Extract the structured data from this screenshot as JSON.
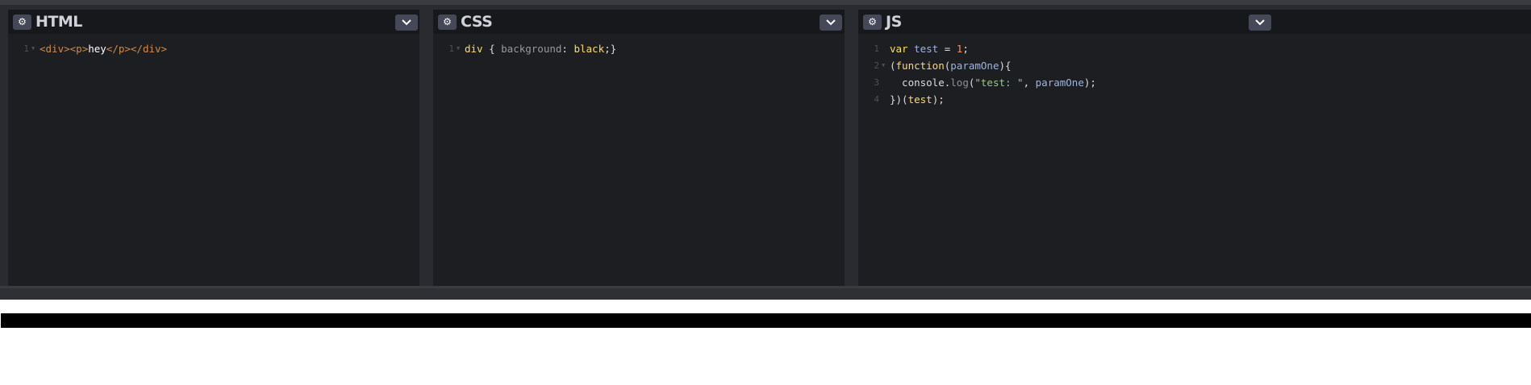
{
  "panels": [
    {
      "title": "HTML",
      "lines": [
        {
          "n": "1",
          "fold": true,
          "tokens": [
            {
              "t": "<div>",
              "c": "t-tag"
            },
            {
              "t": "<p>",
              "c": "t-tag"
            },
            {
              "t": "hey",
              "c": "t-text"
            },
            {
              "t": "</p>",
              "c": "t-tag"
            },
            {
              "t": "</div>",
              "c": "t-tag"
            }
          ]
        }
      ]
    },
    {
      "title": "CSS",
      "lines": [
        {
          "n": "1",
          "fold": true,
          "tokens": [
            {
              "t": "div",
              "c": "t-kw"
            },
            {
              "t": " { ",
              "c": "t-punc"
            },
            {
              "t": "background",
              "c": "t-prop"
            },
            {
              "t": ": ",
              "c": "t-punc"
            },
            {
              "t": "black",
              "c": "t-val"
            },
            {
              "t": ";}",
              "c": "t-punc"
            }
          ]
        }
      ]
    },
    {
      "title": "JS",
      "lines": [
        {
          "n": "1",
          "fold": false,
          "tokens": [
            {
              "t": "var",
              "c": "t-kw"
            },
            {
              "t": " ",
              "c": "t-punc"
            },
            {
              "t": "test",
              "c": "t-var"
            },
            {
              "t": " = ",
              "c": "t-punc"
            },
            {
              "t": "1",
              "c": "t-num"
            },
            {
              "t": ";",
              "c": "t-punc"
            }
          ]
        },
        {
          "n": "2",
          "fold": true,
          "tokens": [
            {
              "t": "(",
              "c": "t-punc"
            },
            {
              "t": "function",
              "c": "t-kw"
            },
            {
              "t": "(",
              "c": "t-punc"
            },
            {
              "t": "paramOne",
              "c": "t-var"
            },
            {
              "t": "){",
              "c": "t-punc"
            }
          ]
        },
        {
          "n": "3",
          "fold": false,
          "tokens": [
            {
              "t": "  console",
              "c": "t-obj"
            },
            {
              "t": ".",
              "c": "t-punc"
            },
            {
              "t": "log",
              "c": "t-meth"
            },
            {
              "t": "(",
              "c": "t-punc"
            },
            {
              "t": "\"test: \"",
              "c": "t-str"
            },
            {
              "t": ", ",
              "c": "t-punc"
            },
            {
              "t": "paramOne",
              "c": "t-var"
            },
            {
              "t": ");",
              "c": "t-punc"
            }
          ]
        },
        {
          "n": "4",
          "fold": false,
          "tokens": [
            {
              "t": "})(",
              "c": "t-punc"
            },
            {
              "t": "test",
              "c": "t-param"
            },
            {
              "t": ");",
              "c": "t-punc"
            }
          ]
        }
      ]
    }
  ],
  "icons": {
    "settings": "gear-icon",
    "dropdown": "chevron-down-icon"
  },
  "preview": {
    "div_background": "#000000"
  }
}
